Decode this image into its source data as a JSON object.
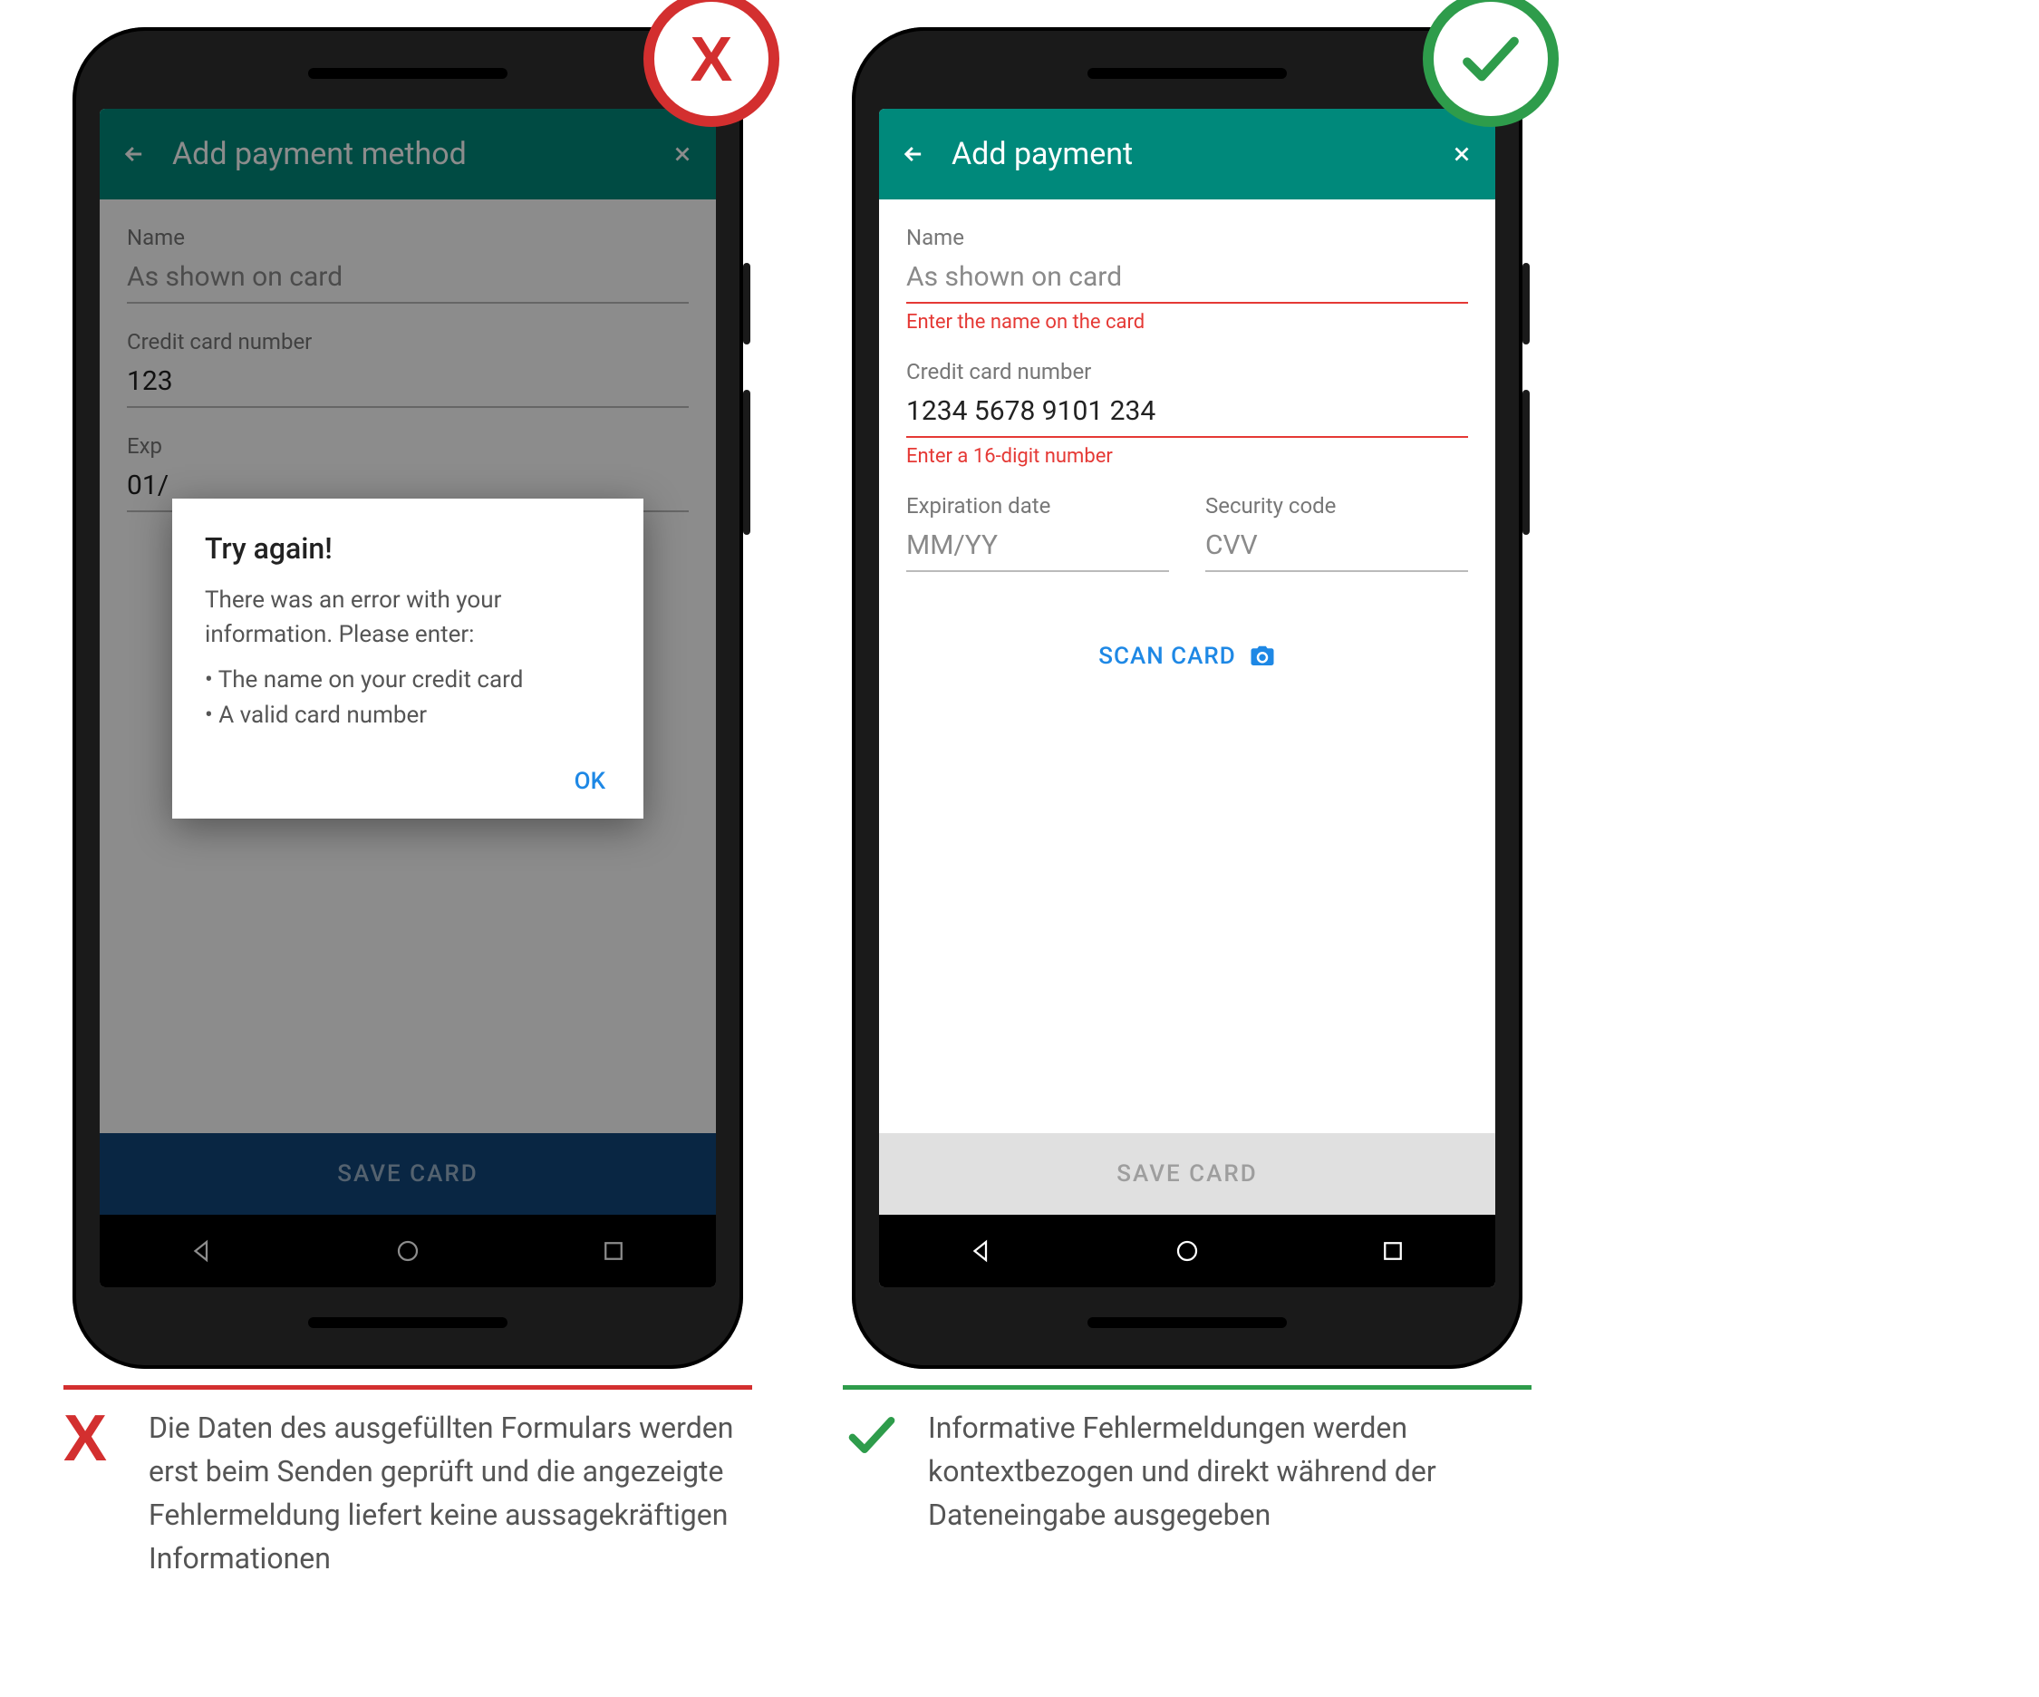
{
  "left": {
    "appbar": {
      "title": "Add payment method"
    },
    "fields": {
      "name": {
        "label": "Name",
        "placeholder": "As shown on card"
      },
      "card": {
        "label": "Credit card number",
        "value": "123"
      },
      "exp": {
        "label": "Exp",
        "value": "01/"
      }
    },
    "dialog": {
      "title": "Try again!",
      "body": "There was an error with your information. Please enter:",
      "items": [
        "The name on your credit card",
        "A valid card number"
      ],
      "ok": "OK"
    },
    "save": "SAVE CARD",
    "caption": "Die Daten des ausgefüllten Formulars werden erst beim Senden geprüft und die angezeigte Fehlermeldung liefert keine aussagekräftigen Informationen"
  },
  "right": {
    "appbar": {
      "title": "Add payment"
    },
    "fields": {
      "name": {
        "label": "Name",
        "placeholder": "As shown on card",
        "error": "Enter the name on the card"
      },
      "card": {
        "label": "Credit card number",
        "value": "1234 5678 9101 234",
        "error": "Enter a 16-digit number"
      },
      "exp": {
        "label": "Expiration date",
        "placeholder": "MM/YY"
      },
      "cvv": {
        "label": "Security code",
        "placeholder": "CVV"
      }
    },
    "scan": "SCAN CARD",
    "save": "SAVE CARD",
    "caption": "Informative Fehlermeldungen werden kontextbezogen und direkt während der Dateneingabe ausgegeben"
  },
  "marks": {
    "bad": "X",
    "good_svg": "check"
  }
}
